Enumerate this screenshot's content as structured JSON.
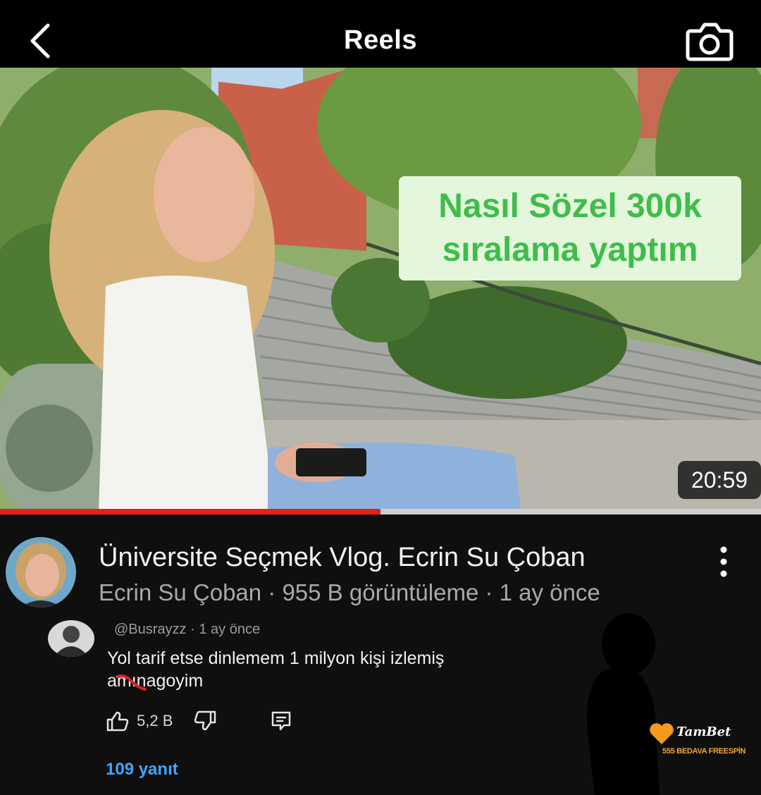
{
  "header": {
    "title": "Reels",
    "back_icon": "chevron-left-icon",
    "camera_icon": "camera-icon"
  },
  "video": {
    "overlay_line1": "Nasıl Sözel 300k",
    "overlay_line2": "sıralama yaptım",
    "duration": "20:59",
    "progress_fraction": 0.5,
    "title": "Üniversite Seçmek Vlog. Ecrin Su Çoban",
    "meta": "Ecrin Su Çoban · 955 B görüntüleme · 1 ay önce",
    "more_icon": "more-vertical-icon"
  },
  "comment": {
    "username": "@Busrayzz",
    "time": "· 1 ay önce",
    "text_line1": "Yol tarif etse dinlemem 1 milyon kişi izlemiş",
    "text_line2_a": "a",
    "text_line2_censored": "mına",
    "text_line2_b": "goyim",
    "likes": "5,2 B",
    "replies": "109 yanıt"
  },
  "watermark": {
    "brand": "TamBet",
    "subtitle": "555 BEDAVA FREESPİN"
  },
  "colors": {
    "accent_red": "#e62117",
    "link_blue": "#3ea6ff",
    "overlay_green": "#3fbd4b",
    "watermark_orange": "#f3a52e"
  }
}
